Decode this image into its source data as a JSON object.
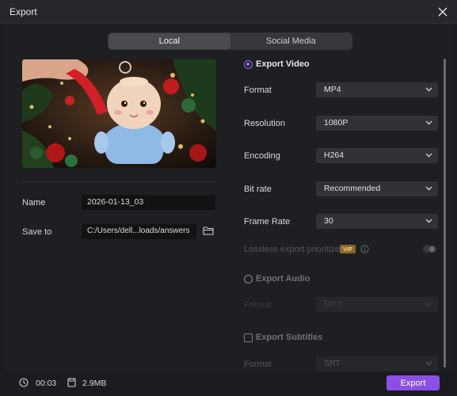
{
  "window": {
    "title": "Export"
  },
  "tabs": [
    {
      "label": "Local"
    },
    {
      "label": "Social Media"
    }
  ],
  "left": {
    "name_label": "Name",
    "name_value": "2026-01-13_03",
    "save_label": "Save to",
    "save_value": "C:/Users/dell...loads/answers"
  },
  "video": {
    "title": "Export Video",
    "rows": [
      {
        "label": "Format",
        "value": "MP4"
      },
      {
        "label": "Resolution",
        "value": "1080P"
      },
      {
        "label": "Encoding",
        "value": "H264"
      },
      {
        "label": "Bit rate",
        "value": "Recommended"
      },
      {
        "label": "Frame Rate",
        "value": "30"
      }
    ],
    "lossless_label": "Lossless export prioritized",
    "vip": "VIP"
  },
  "audio": {
    "title": "Export Audio",
    "format_label": "Format",
    "format_value": "MP3"
  },
  "subtitles": {
    "title": "Export Subtitles",
    "format_label": "Format",
    "format_value": "SRT"
  },
  "footer": {
    "duration": "00:03",
    "size": "2.9MB",
    "export_label": "Export"
  },
  "colors": {
    "accent": "#8c4fe6",
    "radio": "#9b6cf5",
    "background": "#1e1f22"
  },
  "icons": [
    "close-icon",
    "folder-icon",
    "chevron-down-icon",
    "info-icon",
    "clock-icon",
    "file-size-icon"
  ]
}
